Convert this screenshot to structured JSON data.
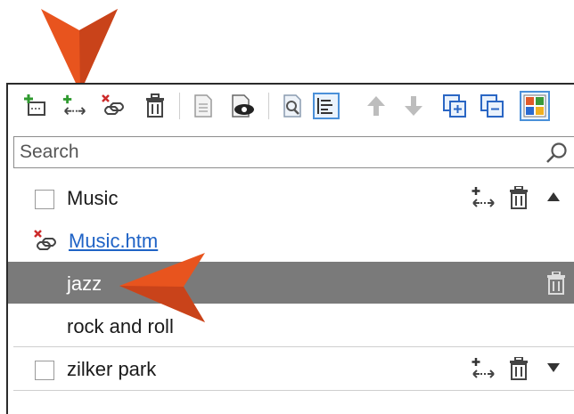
{
  "toolbar": {
    "buttons": [
      {
        "name": "add-folder-icon"
      },
      {
        "name": "add-link-icon"
      },
      {
        "name": "delete-link-icon"
      },
      {
        "name": "delete-icon"
      },
      {
        "name": "text-file-icon"
      },
      {
        "name": "preview-icon"
      },
      {
        "name": "find-icon"
      },
      {
        "name": "align-left-icon",
        "selected": true
      },
      {
        "name": "move-up-icon"
      },
      {
        "name": "move-down-icon"
      },
      {
        "name": "expand-all-icon"
      },
      {
        "name": "collapse-all-icon"
      },
      {
        "name": "color-grid-icon",
        "selected": true
      }
    ]
  },
  "search": {
    "placeholder": "Search",
    "icon": "search-icon"
  },
  "tree": {
    "items": [
      {
        "label": "Music",
        "type": "group",
        "checkbox": true,
        "actions": [
          "add-link-icon",
          "delete-icon",
          "collapse-arrow-icon"
        ]
      },
      {
        "label": "Music.htm",
        "type": "link",
        "icon": "broken-link-icon"
      },
      {
        "label": "jazz",
        "type": "child",
        "selected": true,
        "actions": [
          "delete-icon"
        ]
      },
      {
        "label": "rock and roll",
        "type": "child"
      },
      {
        "label": "zilker park",
        "type": "group",
        "checkbox": true,
        "actions": [
          "add-link-icon",
          "delete-icon",
          "expand-arrow-icon"
        ]
      }
    ]
  },
  "colors": {
    "callout_arrow": "#e8541e",
    "selected_row": "#7a7a7a",
    "link": "#1f63c6",
    "toolbar_accent": "#4a90d9"
  }
}
